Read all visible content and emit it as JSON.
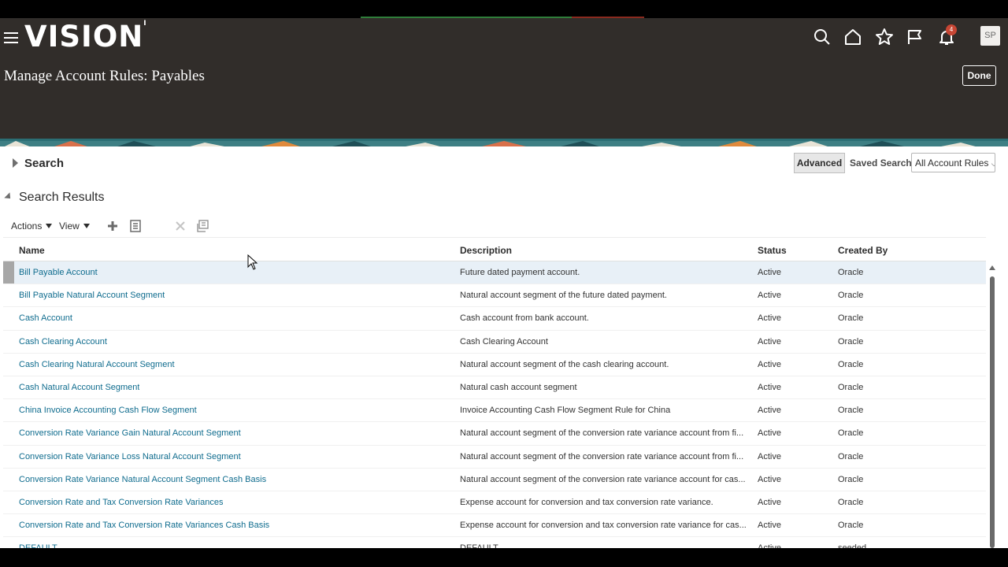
{
  "app": {
    "logo_text": "VISION",
    "logo_mark": "I"
  },
  "header": {
    "page_title": "Manage Account Rules: Payables",
    "done_label": "Done",
    "notification_count": "4",
    "user_initials": "SP",
    "icons": [
      "search-icon",
      "home-icon",
      "star-icon",
      "flag-icon",
      "bell-icon"
    ]
  },
  "search": {
    "toggle_label": "Search",
    "advanced_label": "Advanced",
    "saved_search_label": "Saved Search",
    "saved_search_value": "All Account Rules"
  },
  "results": {
    "title": "Search Results",
    "toolbar": {
      "actions_label": "Actions",
      "view_label": "View"
    },
    "columns": {
      "name": "Name",
      "description": "Description",
      "status": "Status",
      "created_by": "Created By"
    },
    "rows": [
      {
        "name": "Bill Payable Account",
        "description": "Future dated payment account.",
        "status": "Active",
        "created_by": "Oracle"
      },
      {
        "name": "Bill Payable Natural Account Segment",
        "description": "Natural account segment of the future dated payment.",
        "status": "Active",
        "created_by": "Oracle"
      },
      {
        "name": "Cash Account",
        "description": "Cash account from bank account.",
        "status": "Active",
        "created_by": "Oracle"
      },
      {
        "name": "Cash Clearing Account",
        "description": "Cash Clearing Account",
        "status": "Active",
        "created_by": "Oracle"
      },
      {
        "name": "Cash Clearing Natural Account Segment",
        "description": "Natural account segment of the cash clearing account.",
        "status": "Active",
        "created_by": "Oracle"
      },
      {
        "name": "Cash Natural Account Segment",
        "description": "Natural cash account segment",
        "status": "Active",
        "created_by": "Oracle"
      },
      {
        "name": "China Invoice Accounting Cash Flow Segment",
        "description": "Invoice Accounting Cash Flow Segment Rule for China",
        "status": "Active",
        "created_by": "Oracle"
      },
      {
        "name": "Conversion Rate Variance Gain Natural Account Segment",
        "description": "Natural account segment of the conversion rate variance account from fi...",
        "status": "Active",
        "created_by": "Oracle"
      },
      {
        "name": "Conversion Rate Variance Loss Natural Account Segment",
        "description": "Natural account segment of the conversion rate variance account from fi...",
        "status": "Active",
        "created_by": "Oracle"
      },
      {
        "name": "Conversion Rate Variance Natural Account Segment Cash Basis",
        "description": "Natural account segment of the conversion rate variance account for cas...",
        "status": "Active",
        "created_by": "Oracle"
      },
      {
        "name": "Conversion Rate and Tax Conversion Rate Variances",
        "description": "Expense account for conversion and tax conversion rate variance.",
        "status": "Active",
        "created_by": "Oracle"
      },
      {
        "name": "Conversion Rate and Tax Conversion Rate Variances Cash Basis",
        "description": "Expense account for conversion and tax conversion rate variance for cas...",
        "status": "Active",
        "created_by": "Oracle"
      },
      {
        "name": "DEFAULT",
        "description": "DEFAULT",
        "status": "Active",
        "created_by": "seeded"
      }
    ]
  }
}
